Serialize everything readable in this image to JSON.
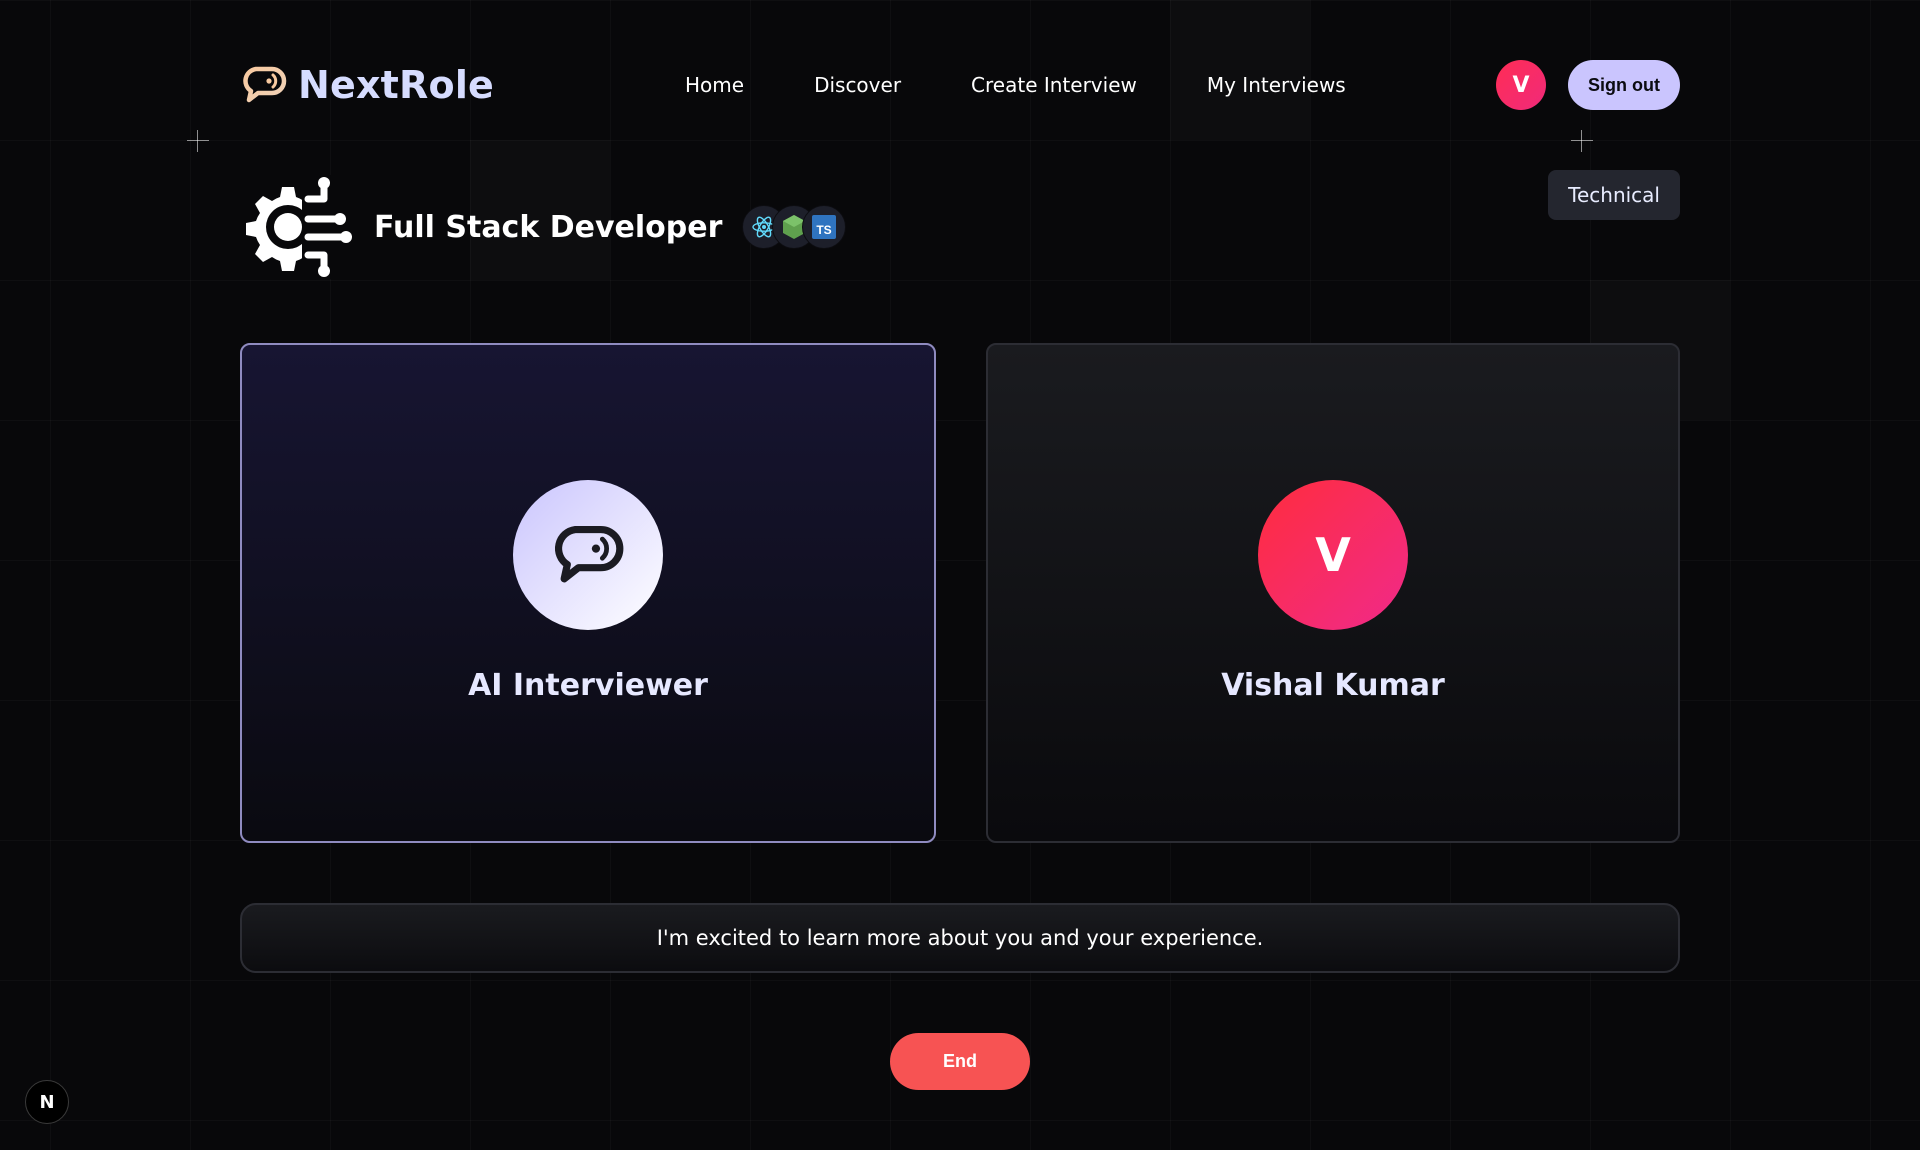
{
  "brand": {
    "name": "NextRole",
    "logo_icon": "chat-logo-icon"
  },
  "nav": {
    "links": [
      "Home",
      "Discover",
      "Create Interview",
      "My Interviews"
    ]
  },
  "user": {
    "initial": "V",
    "signout_label": "Sign out"
  },
  "interview": {
    "role": "Full Stack Developer",
    "type": "Technical",
    "tech_stack": [
      {
        "name": "React",
        "icon": "react-icon"
      },
      {
        "name": "Node.js",
        "icon": "nodejs-icon"
      },
      {
        "name": "TypeScript",
        "icon": "typescript-icon",
        "text": "TS"
      }
    ]
  },
  "interviewer": {
    "name": "AI Interviewer",
    "icon": "chat-bubble-icon"
  },
  "candidate": {
    "name": "Vishal Kumar",
    "initial": "V"
  },
  "transcript": {
    "message": "I'm excited to learn more about you and your experience."
  },
  "controls": {
    "end_label": "End"
  },
  "dev_indicator": {
    "letter": "N"
  },
  "colors": {
    "accent": "#cac5fe",
    "brand_text": "#d6dcff",
    "danger": "#f75353",
    "avatar_gradient": [
      "#ff2d3d",
      "#f02a8a"
    ]
  }
}
